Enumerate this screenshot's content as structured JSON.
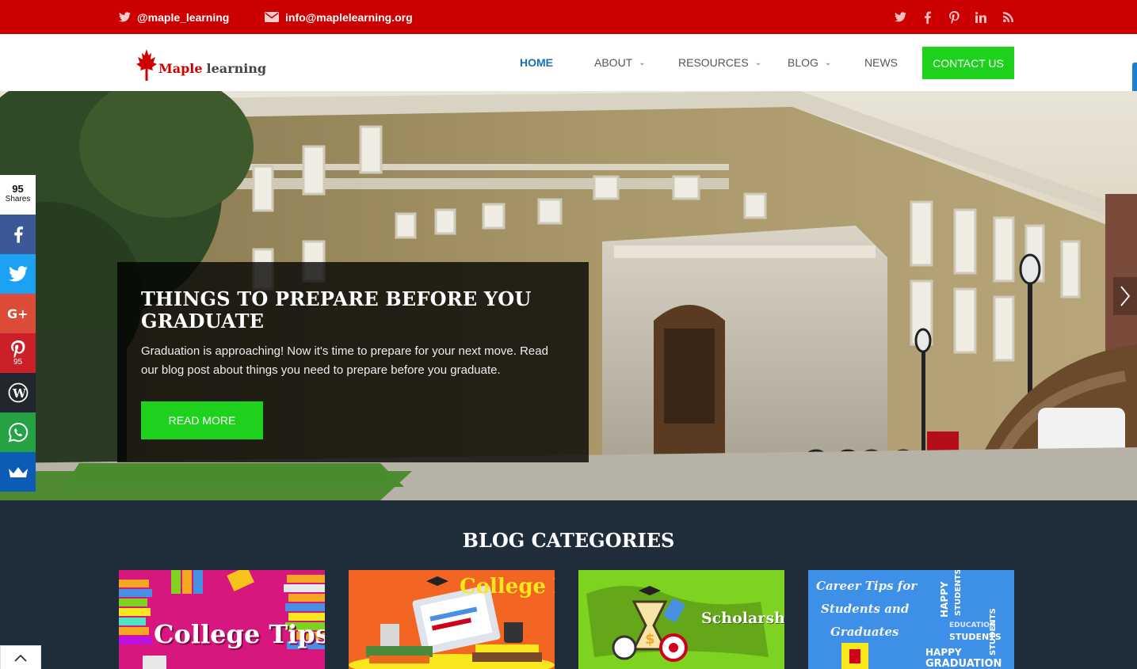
{
  "topbar": {
    "twitter_handle": "@maple_learning",
    "email": "info@maplelearning.org",
    "social_icons": [
      "twitter-icon",
      "facebook-icon",
      "pinterest-icon",
      "linkedin-icon",
      "rss-icon"
    ],
    "background": "#cc0000"
  },
  "header": {
    "logo_word1": "Maple",
    "logo_word2": "learning",
    "nav": [
      {
        "label": "HOME",
        "active": true
      },
      {
        "label": "ABOUT",
        "dropdown": true
      },
      {
        "label": "RESOURCES",
        "dropdown": true
      },
      {
        "label": "BLOG",
        "dropdown": true
      },
      {
        "label": "NEWS"
      }
    ],
    "contact_label": "CONTACT US",
    "accent": "#1dd11d",
    "active_color": "#1a6fb5"
  },
  "hero": {
    "title": "THINGS TO PREPARE BEFORE YOU GRADUATE",
    "text": "Graduation is approaching! Now it's time to prepare for your next move. Read our blog post about things you need to prepare before you graduate.",
    "button": "READ MORE"
  },
  "share": {
    "count": "95",
    "count_label": "Shares",
    "buttons": [
      {
        "icon": "facebook-icon",
        "color": "#3b5998"
      },
      {
        "icon": "twitter-icon",
        "color": "#1da1f2"
      },
      {
        "icon": "google-plus-icon",
        "color": "#dd4b39"
      },
      {
        "icon": "pinterest-icon",
        "color": "#cb2027",
        "count": "95"
      },
      {
        "icon": "wordpress-icon",
        "color": "#21272c"
      },
      {
        "icon": "whatsapp-icon",
        "color": "#25a244"
      },
      {
        "icon": "sumo-crown-icon",
        "color": "#0c5bb5"
      }
    ]
  },
  "categories": {
    "heading": "BLOG CATEGORIES",
    "items": [
      {
        "label": "College Tips",
        "color": "#d8177e"
      },
      {
        "label": "College Life",
        "color": "#f26522"
      },
      {
        "label": "Scholarships",
        "color": "#7ed320"
      },
      {
        "label_lines": [
          "Career Tips for",
          "Students and",
          "Graduates"
        ],
        "color": "#3d8fe8"
      }
    ]
  }
}
